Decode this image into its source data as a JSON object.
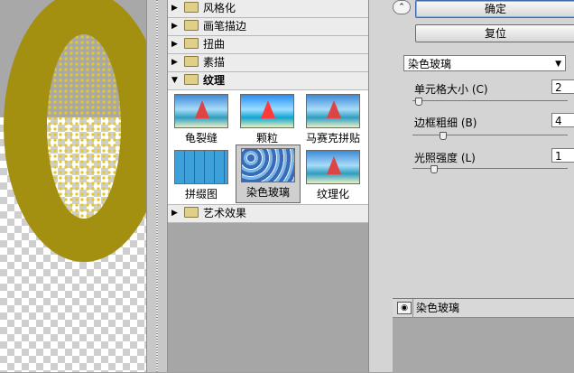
{
  "categories_top": [
    {
      "label": "风格化"
    },
    {
      "label": "画笔描边"
    },
    {
      "label": "扭曲"
    },
    {
      "label": "素描"
    }
  ],
  "category_open": {
    "label": "纹理"
  },
  "thumbs": [
    {
      "label": "龟裂缝"
    },
    {
      "label": "颗粒"
    },
    {
      "label": "马赛克拼贴"
    },
    {
      "label": "拼缀图"
    },
    {
      "label": "染色玻璃"
    },
    {
      "label": "纹理化"
    }
  ],
  "categories_bottom": [
    {
      "label": "艺术效果"
    }
  ],
  "panel": {
    "ok_label": "确定",
    "reset_label": "复位",
    "filter_select": "染色玻璃",
    "params": [
      {
        "label": "单元格大小 (C)",
        "value": "2",
        "slider": 0.02
      },
      {
        "label": "边框粗细 (B)",
        "value": "4",
        "slider": 0.18
      },
      {
        "label": "光照强度 (L)",
        "value": "1",
        "slider": 0.12
      }
    ],
    "layer_name": "染色玻璃"
  },
  "icons": {
    "collapse": "collapse-arrows-icon",
    "eye": "eye-icon",
    "folder": "folder-icon"
  }
}
